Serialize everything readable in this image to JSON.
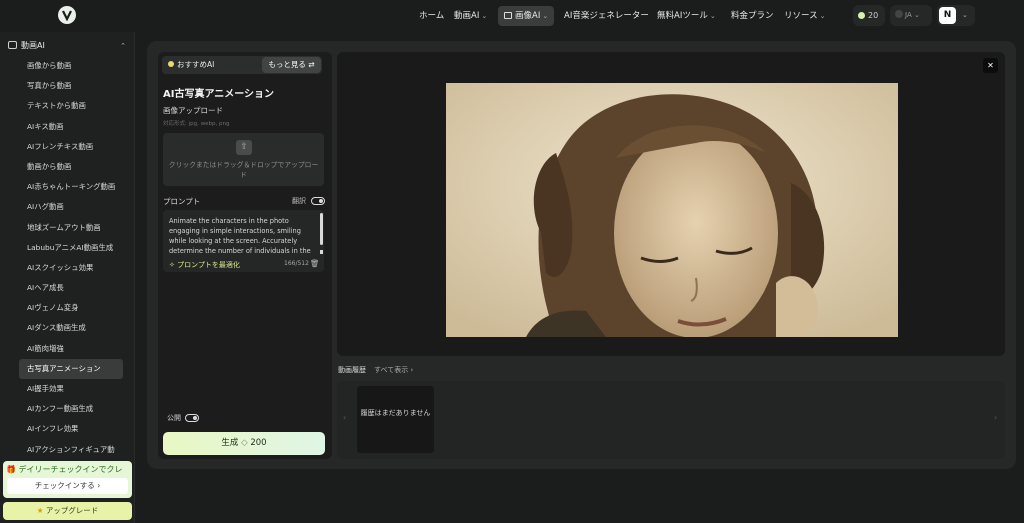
{
  "nav": {
    "home": "ホーム",
    "video_ai": "動画AI",
    "image_ai": "画像AI",
    "music": "AI音楽ジェネレーター",
    "free_tools": "無料AIツール",
    "pricing": "料金プラン",
    "resources": "リソース"
  },
  "header": {
    "credits": "20",
    "language": "JA",
    "user_initial": "N"
  },
  "sidebar": {
    "section": "動画AI",
    "items": [
      "画像から動画",
      "写真から動画",
      "テキストから動画",
      "AIキス動画",
      "AIフレンチキス動画",
      "動画から動画",
      "AI赤ちゃんトーキング動画",
      "AIハグ動画",
      "地球ズームアウト動画",
      "LabubuアニメAI動画生成",
      "AIスクイッシュ効果",
      "AIヘア成長",
      "AIヴェノム変身",
      "AIダンス動画生成",
      "AI筋肉増強",
      "古写真アニメーション",
      "AI握手効果",
      "AIカンフー動画生成",
      "AIインフレ効果",
      "AIアクションフィギュア動"
    ],
    "active_index": 15,
    "checkin_text": "デイリーチェックインでクレ",
    "checkin_button": "チェックインする",
    "upgrade": "アップグレード"
  },
  "tool": {
    "recommended": "おすすめAI",
    "more": "もっと見る",
    "title": "AI古写真アニメーション",
    "upload_label": "画像アップロード",
    "formats": "対応形式: jpg, webp, png",
    "upload_hint": "クリックまたはドラッグ＆ドロップでアップロード",
    "prompt_label": "プロンプト",
    "translate": "翻訳",
    "prompt_text": "Animate the characters in the photo engaging in simple interactions, smiling while looking at the screen. Accurately determine the number of individuals in the image.",
    "optimize": "プロンプトを最適化",
    "char_count": "166/512",
    "public": "公開",
    "generate": "生成",
    "cost": "200"
  },
  "history": {
    "label": "動画履歴",
    "view_all": "すべて表示",
    "empty": "履歴はまだありません"
  },
  "colors": {
    "accent": "#d7ec8e",
    "background": "#1b1d1c"
  }
}
